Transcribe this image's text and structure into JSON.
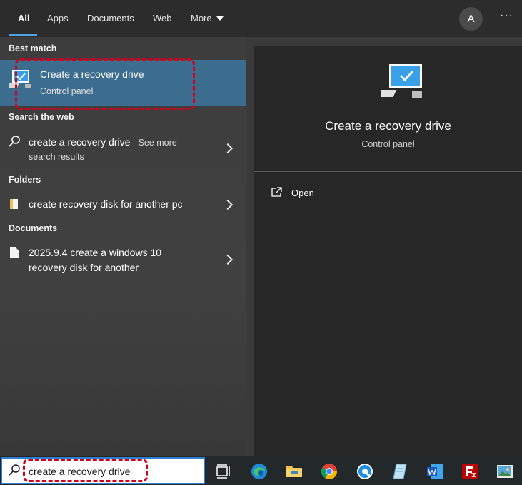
{
  "tabs": [
    {
      "label": "All",
      "active": true
    },
    {
      "label": "Apps"
    },
    {
      "label": "Documents"
    },
    {
      "label": "Web"
    },
    {
      "label": "More"
    }
  ],
  "account": {
    "initial": "A"
  },
  "options_label": "···",
  "best_match": {
    "heading": "Best match",
    "title": "Create a recovery drive",
    "subtitle": "Control panel"
  },
  "web": {
    "heading": "Search the web",
    "query": "create a recovery drive",
    "suffix": " - See more",
    "line2": "search results"
  },
  "folders": {
    "heading": "Folders",
    "item": "create recovery disk for another pc"
  },
  "documents": {
    "heading": "Documents",
    "line1": "2025.9.4 create a windows 10",
    "line2": "recovery disk for another"
  },
  "preview": {
    "title": "Create a recovery drive",
    "subtitle": "Control panel",
    "action": "Open"
  },
  "search": {
    "value": "create a recovery drive"
  },
  "taskbar_icons": [
    "task-view-icon",
    "edge-icon",
    "file-explorer-icon",
    "chrome-icon",
    "qq-browser-icon",
    "notepad-icon",
    "word-icon",
    "filezilla-icon",
    "photos-icon"
  ],
  "colors": {
    "accent": "#4ca3e6",
    "highlight_row": "#3c6d8f",
    "annotation": "#d0021b"
  }
}
